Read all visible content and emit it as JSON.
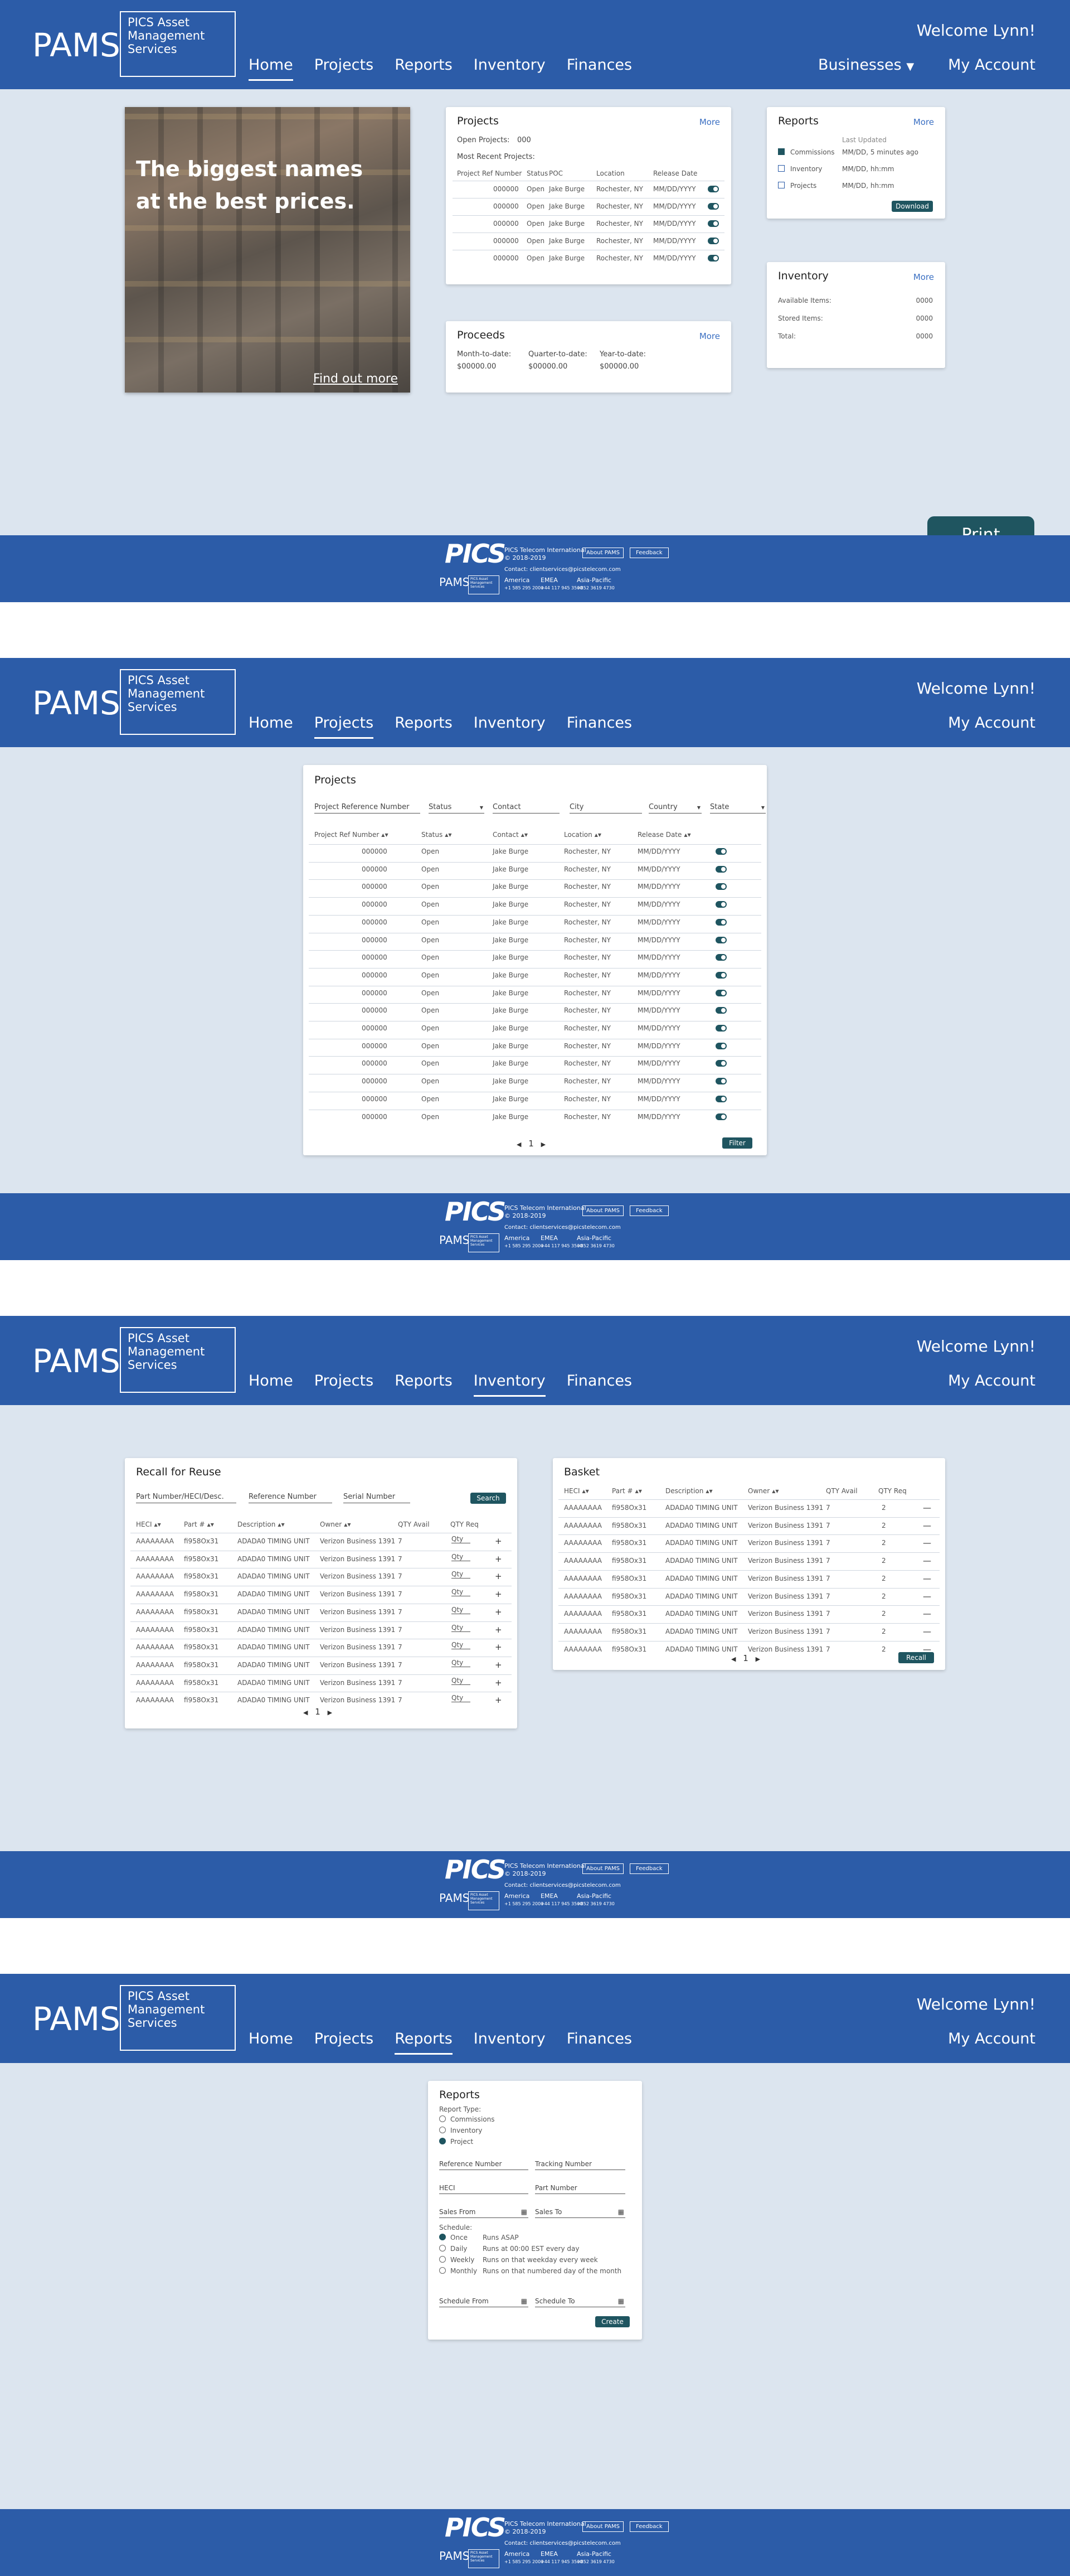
{
  "brand": {
    "name": "PAMS",
    "subtitle": "PICS Asset Management Services"
  },
  "nav": {
    "home": "Home",
    "projects": "Projects",
    "reports": "Reports",
    "inventory": "Inventory",
    "finances": "Finances",
    "businesses": "Businesses",
    "my_account": "My Account",
    "welcome": "Welcome Lynn!"
  },
  "footer": {
    "logo": "PICS",
    "company": "PICS Telecom International",
    "copyright": "© 2018-2019",
    "about": "About PAMS",
    "feedback": "Feedback",
    "contact": "Contact: clientservices@picstelecom.com",
    "brand": "PAMS",
    "regions": [
      {
        "name": "America",
        "phone": "+1 585 295 2000"
      },
      {
        "name": "EMEA",
        "phone": "+44 117 945 3500"
      },
      {
        "name": "Asia-Pacific",
        "phone": "+852 3619 4730"
      }
    ]
  },
  "home": {
    "hero": {
      "headline_1": "The biggest names",
      "headline_2": "at the best prices.",
      "link": "Find out more"
    },
    "projects": {
      "title": "Projects",
      "more": "More",
      "open_label": "Open Projects:",
      "open_value": "000",
      "recent_label": "Most Recent Projects:",
      "columns": [
        "Project Ref Number",
        "Status",
        "POC",
        "Location",
        "Release Date"
      ],
      "rows": [
        [
          "000000",
          "Open",
          "Jake Burge",
          "Rochester, NY",
          "MM/DD/YYYY"
        ],
        [
          "000000",
          "Open",
          "Jake Burge",
          "Rochester, NY",
          "MM/DD/YYYY"
        ],
        [
          "000000",
          "Open",
          "Jake Burge",
          "Rochester, NY",
          "MM/DD/YYYY"
        ],
        [
          "000000",
          "Open",
          "Jake Burge",
          "Rochester, NY",
          "MM/DD/YYYY"
        ],
        [
          "000000",
          "Open",
          "Jake Burge",
          "Rochester, NY",
          "MM/DD/YYYY"
        ]
      ]
    },
    "proceeds": {
      "title": "Proceeds",
      "more": "More",
      "labels": [
        "Month-to-date:",
        "Quarter-to-date:",
        "Year-to-date:"
      ],
      "values": [
        "$00000.00",
        "$00000.00",
        "$00000.00"
      ]
    },
    "reports": {
      "title": "Reports",
      "more": "More",
      "last_updated": "Last Updated",
      "items": [
        {
          "name": "Commissions",
          "checked": true,
          "updated": "MM/DD, 5 minutes ago"
        },
        {
          "name": "Inventory",
          "checked": false,
          "updated": "MM/DD, hh:mm"
        },
        {
          "name": "Projects",
          "checked": false,
          "updated": "MM/DD, hh:mm"
        }
      ],
      "download": "Download"
    },
    "inventory": {
      "title": "Inventory",
      "more": "More",
      "rows": [
        {
          "label": "Available Items:",
          "value": "0000"
        },
        {
          "label": "Stored Items:",
          "value": "0000"
        },
        {
          "label": "Total:",
          "value": "0000"
        }
      ]
    },
    "print": "Print"
  },
  "projects_page": {
    "title": "Projects",
    "filters": [
      "Project Reference Number",
      "Status",
      "Contact",
      "City",
      "Country",
      "State"
    ],
    "columns": [
      "Project Ref Number",
      "Status",
      "Contact",
      "Location",
      "Release Date"
    ],
    "row": [
      "000000",
      "Open",
      "Jake Burge",
      "Rochester, NY",
      "MM/DD/YYYY"
    ],
    "row_count": 16,
    "page": "1",
    "filter_button": "Filter"
  },
  "inventory_page": {
    "recall": {
      "title": "Recall for Reuse",
      "fields": [
        "Part Number/HECI/Desc.",
        "Reference Number",
        "Serial Number"
      ],
      "search": "Search",
      "columns": [
        "HECI",
        "Part #",
        "Description",
        "Owner",
        "QTY Avail",
        "QTY Req"
      ],
      "row": [
        "AAAAAAAA",
        "fi958Ox31",
        "ADADA0 TIMING UNIT",
        "Verizon Business 1391",
        "7",
        "Qty"
      ],
      "row_count": 10,
      "page": "1"
    },
    "basket": {
      "title": "Basket",
      "columns": [
        "HECI",
        "Part #",
        "Description",
        "Owner",
        "QTY Avail",
        "QTY Req"
      ],
      "row": [
        "AAAAAAAA",
        "fi958Ox31",
        "ADADA0 TIMING UNIT",
        "Verizon Business 1391",
        "7",
        "2"
      ],
      "row_count": 9,
      "page": "1",
      "recall": "Recall"
    }
  },
  "reports_page": {
    "title": "Reports",
    "report_type": "Report Type:",
    "types": [
      {
        "label": "Commissions",
        "on": false
      },
      {
        "label": "Inventory",
        "on": false
      },
      {
        "label": "Project",
        "on": true
      }
    ],
    "fields": [
      "Reference Number",
      "Tracking Number",
      "HECI",
      "Part Number",
      "Sales From",
      "Sales To"
    ],
    "schedule": "Schedule:",
    "schedules": [
      {
        "label": "Once",
        "desc": "Runs ASAP",
        "on": true
      },
      {
        "label": "Daily",
        "desc": "Runs at 00:00 EST every day",
        "on": false
      },
      {
        "label": "Weekly",
        "desc": "Runs on that weekday every week",
        "on": false
      },
      {
        "label": "Monthly",
        "desc": "Runs on that numbered day of the month",
        "on": false
      }
    ],
    "schedule_from": "Schedule From",
    "schedule_to": "Schedule To",
    "create": "Create"
  }
}
